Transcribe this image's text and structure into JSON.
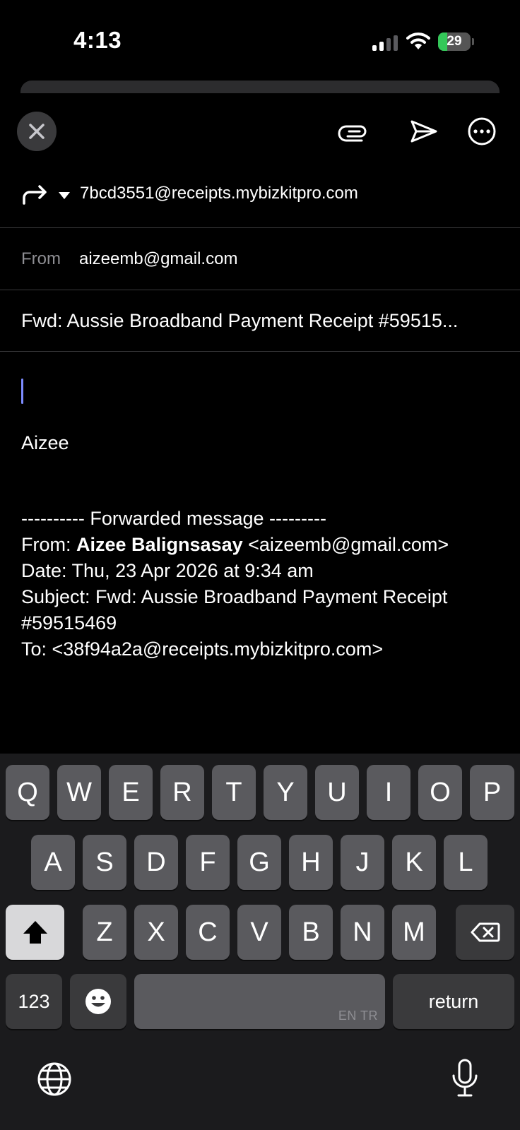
{
  "status_bar": {
    "time": "4:13",
    "battery_percent": "29",
    "battery_level": 0.29,
    "icons": [
      "cellular-signal-icon",
      "wifi-icon",
      "battery-charging-icon"
    ]
  },
  "toolbar": {
    "icons": [
      "close-icon",
      "paperclip-icon",
      "send-icon",
      "more-icon"
    ]
  },
  "compose": {
    "to_address": "7bcd3551@receipts.mybizkitpro.com",
    "from_label": "From",
    "from_address": "aizeemb@gmail.com",
    "subject": "Fwd: Aussie Broadband Payment Receipt #59515..."
  },
  "body": {
    "signature": "Aizee",
    "forwarded_header": "---------- Forwarded message ---------",
    "from_prefix": "From: ",
    "from_name": "Aizee Balignsasay",
    "from_email": " <aizeemb@gmail.com>",
    "date_line": "Date: Thu, 23 Apr 2026 at 9:34 am",
    "subject_line_1": "Subject: Fwd: Aussie Broadband Payment Receipt",
    "subject_line_2": "#59515469",
    "to_line": "To: <38f94a2a@receipts.mybizkitpro.com>"
  },
  "keyboard": {
    "row1": [
      "Q",
      "W",
      "E",
      "R",
      "T",
      "Y",
      "U",
      "I",
      "O",
      "P"
    ],
    "row2": [
      "A",
      "S",
      "D",
      "F",
      "G",
      "H",
      "J",
      "K",
      "L"
    ],
    "row3": [
      "Z",
      "X",
      "C",
      "V",
      "B",
      "N",
      "M"
    ],
    "numbers_label": "123",
    "space_sub_label": "EN TR",
    "return_label": "return"
  },
  "colors": {
    "background": "#000000",
    "keyboard_bg": "#1b1b1d",
    "key_bg": "#5a5a5e",
    "cursor": "#7d8cff",
    "battery_green": "#34c759",
    "secondary_text": "#8e8e93"
  }
}
